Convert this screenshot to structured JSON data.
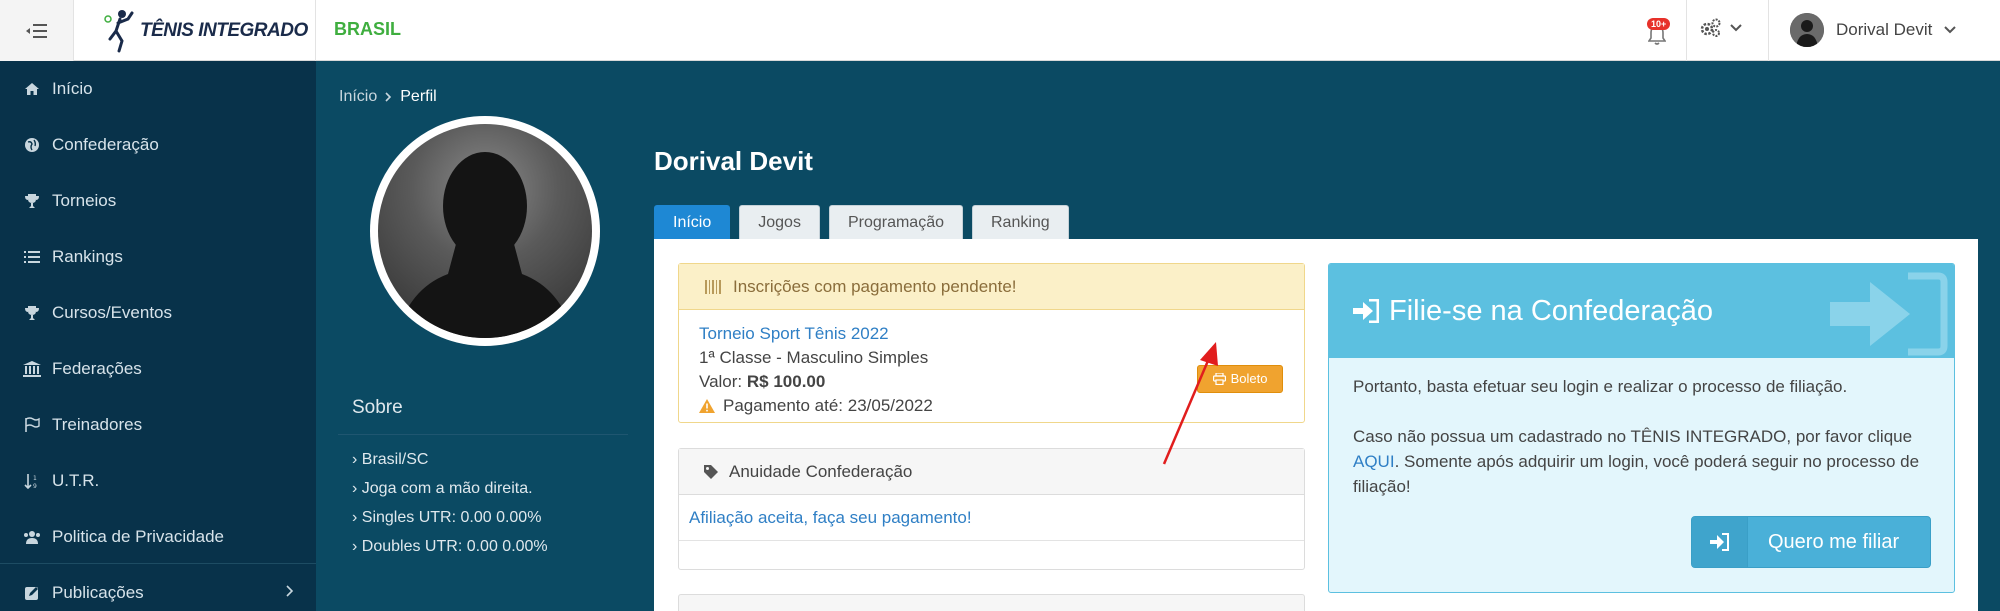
{
  "header": {
    "logo_text": "TÊNIS INTEGRADO",
    "brand_label": "BRASIL",
    "notifications_badge": "10+",
    "user_name": "Dorival Devit"
  },
  "sidebar": {
    "items": [
      {
        "label": "Início",
        "icon": "home-icon"
      },
      {
        "label": "Confederação",
        "icon": "globe-icon"
      },
      {
        "label": "Torneios",
        "icon": "trophy-icon"
      },
      {
        "label": "Rankings",
        "icon": "list-icon"
      },
      {
        "label": "Cursos/Eventos",
        "icon": "trophy-icon"
      },
      {
        "label": "Federações",
        "icon": "institution-icon"
      },
      {
        "label": "Treinadores",
        "icon": "flag-icon"
      },
      {
        "label": "U.T.R.",
        "icon": "sort-icon"
      },
      {
        "label": "Politica de Privacidade",
        "icon": "users-icon"
      },
      {
        "label": "Publicações",
        "icon": "edit-icon"
      }
    ]
  },
  "breadcrumb": {
    "home": "Início",
    "current": "Perfil"
  },
  "about": {
    "title": "Sobre",
    "items": [
      "Brasil/SC",
      "Joga com a mão direita.",
      "Singles UTR: 0.00 0.00%",
      "Doubles UTR: 0.00 0.00%"
    ]
  },
  "profile": {
    "name": "Dorival Devit",
    "tabs": [
      "Início",
      "Jogos",
      "Programação",
      "Ranking"
    ],
    "active_tab": "Início"
  },
  "pending": {
    "header": "Inscrições com pagamento pendente!",
    "tournament": "Torneio Sport Tênis 2022",
    "category": "1ª Classe - Masculino Simples",
    "value_label": "Valor:",
    "value": "R$ 100.00",
    "due_label": "Pagamento até: 23/05/2022",
    "boleto_label": "Boleto"
  },
  "annuity": {
    "header": "Anuidade Confederação",
    "status": "Afiliação aceita, faça seu pagamento!"
  },
  "filie": {
    "title": "Filie-se na Confederação",
    "p1": "Portanto, basta efetuar seu login e realizar o processo de filiação.",
    "p2_a": "Caso não possua um cadastrado no TÊNIS INTEGRADO, por favor clique",
    "p2_link": "AQUI",
    "p2_b": ". Somente após adquirir um login, você poderá seguir no processo de filiação!",
    "button_label": "Quero me filiar"
  },
  "colors": {
    "sidebar_bg": "#08324a",
    "content_bg": "#0b4a63",
    "brand_green": "#3fae3f",
    "active_tab": "#1e88d4",
    "boleto_orange": "#f0a32f",
    "info_blue": "#5cc0e0",
    "annotation_red": "#e11d1d"
  }
}
